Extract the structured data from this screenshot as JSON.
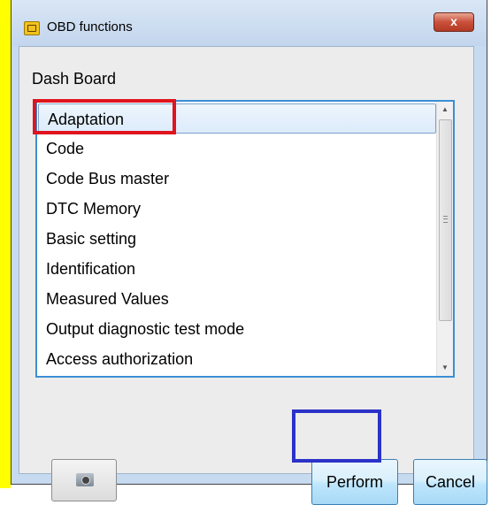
{
  "window": {
    "title": "OBD functions",
    "close_label": "x"
  },
  "group": {
    "label": "Dash Board"
  },
  "list": {
    "items": [
      {
        "label": "Adaptation",
        "selected": true
      },
      {
        "label": "Code",
        "selected": false
      },
      {
        "label": "Code Bus master",
        "selected": false
      },
      {
        "label": "DTC Memory",
        "selected": false
      },
      {
        "label": "Basic setting",
        "selected": false
      },
      {
        "label": "Identification",
        "selected": false
      },
      {
        "label": "Measured Values",
        "selected": false
      },
      {
        "label": "Output diagnostic test mode",
        "selected": false
      },
      {
        "label": "Access authorization",
        "selected": false
      }
    ]
  },
  "buttons": {
    "perform_label": "Perform",
    "cancel_label": "Cancel",
    "camera_icon": "camera-icon"
  },
  "colors": {
    "annotation_red": "#e0141e",
    "annotation_blue": "#2b32c8",
    "left_margin_yellow": "#ffff00"
  }
}
